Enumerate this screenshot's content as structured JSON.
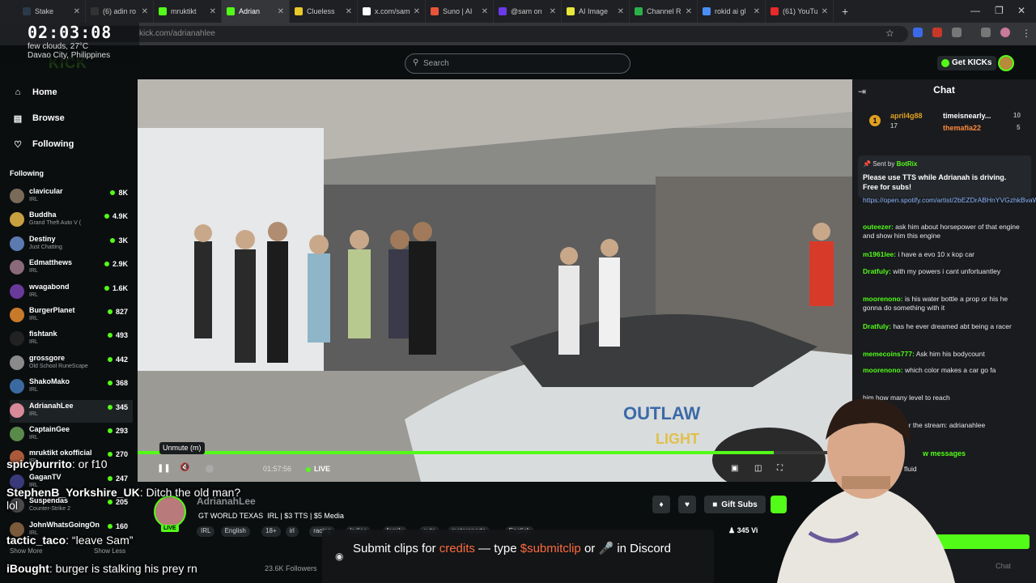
{
  "browser": {
    "tabs": [
      {
        "label": "Stake",
        "color": "#2b3a4a",
        "active": false
      },
      {
        "label": "(6) adin ro",
        "color": "#333",
        "active": false
      },
      {
        "label": "mruktikt",
        "color": "#53fc18",
        "active": false
      },
      {
        "label": "Adrian",
        "color": "#53fc18",
        "active": true
      },
      {
        "label": "Clueless",
        "color": "#e9c82a",
        "active": false
      },
      {
        "label": "x.com/sam",
        "color": "#fff",
        "active": false
      },
      {
        "label": "Suno | AI",
        "color": "#e8553a",
        "active": false
      },
      {
        "label": "@sam on",
        "color": "#6b3ae8",
        "active": false
      },
      {
        "label": "AI Image",
        "color": "#e8e83a",
        "active": false
      },
      {
        "label": "Channel R",
        "color": "#2ab04a",
        "active": false
      },
      {
        "label": "rokid ai gl",
        "color": "#4a8ef5",
        "active": false
      },
      {
        "label": "(61) YouTu",
        "color": "#e82a2a",
        "active": false
      }
    ],
    "address": "kick.com/adrianahlee"
  },
  "clock": {
    "time": "02:03:08",
    "weather": "few clouds, 27°C",
    "location": "Davao City, Philippines"
  },
  "header": {
    "search_placeholder": "Search",
    "get_kicks": "Get KICKs",
    "logo": "KICK"
  },
  "nav": {
    "home": "Home",
    "browse": "Browse",
    "following": "Following"
  },
  "following": {
    "header": "Following",
    "channels": [
      {
        "name": "clavicular",
        "category": "IRL",
        "viewers": "8K",
        "color": "#7a6a5a"
      },
      {
        "name": "Buddha",
        "category": "Grand Theft Auto V (",
        "viewers": "4.9K",
        "color": "#c8a040"
      },
      {
        "name": "Destiny",
        "category": "Just Chatting",
        "viewers": "3K",
        "color": "#5a7ab0"
      },
      {
        "name": "Edmatthews",
        "category": "IRL",
        "viewers": "2.9K",
        "color": "#8a6a7a"
      },
      {
        "name": "wvagabond",
        "category": "IRL",
        "viewers": "1.6K",
        "color": "#6a3a9a"
      },
      {
        "name": "BurgerPlanet",
        "category": "IRL",
        "viewers": "827",
        "color": "#c87a2a"
      },
      {
        "name": "fishtank",
        "category": "IRL",
        "viewers": "493",
        "color": "#222"
      },
      {
        "name": "grossgore",
        "category": "Old School RuneScape",
        "viewers": "442",
        "color": "#8a8a8a"
      },
      {
        "name": "ShakoMako",
        "category": "IRL",
        "viewers": "368",
        "color": "#3a6aa0"
      },
      {
        "name": "AdrianahLee",
        "category": "IRL",
        "viewers": "345",
        "color": "#d88a9a"
      },
      {
        "name": "CaptainGee",
        "category": "IRL",
        "viewers": "293",
        "color": "#5a8a4a"
      },
      {
        "name": "mruktikt okofficial",
        "category": "IRL",
        "viewers": "270",
        "color": "#aa5a3a"
      },
      {
        "name": "GaganTV",
        "category": "IRL",
        "viewers": "247",
        "color": "#3a3a7a"
      },
      {
        "name": "Suspendas",
        "category": "Counter-Strike 2",
        "viewers": "205",
        "color": "#4a4a4a"
      },
      {
        "name": "JohnWhatsGoingOn",
        "category": "IRL",
        "viewers": "160",
        "color": "#7a5a3a"
      }
    ],
    "show_more": "Show More",
    "show_less": "Show Less"
  },
  "player": {
    "tooltip": "Unmute (m)",
    "elapsed": "01:57:56",
    "live": "LIVE",
    "progress": 0.89
  },
  "stream": {
    "streamer": "AdrianahLee",
    "live_badge": "LIVE",
    "title": "GT WORLD TEXAS  IRL | $3 TTS | $5 Media",
    "tags": [
      "IRL",
      "English",
      "18+",
      "irl",
      "racing",
      "ladies",
      "family",
      "cute",
      "motorsports",
      "English"
    ],
    "viewers": "345 Vi",
    "followers": "23.6K Followers",
    "gift_subs": "Gift Subs"
  },
  "chat": {
    "title": "Chat",
    "gifters": [
      {
        "rank": "1",
        "name": "april4g88",
        "count": "17"
      },
      {
        "name": "timeisnearly...",
        "count": "10"
      },
      {
        "name": "themafia22",
        "count": "5"
      }
    ],
    "pinned": {
      "sent_by_label": "Sent by",
      "sender": "BotRix",
      "message": "Please use TTS while Adrianah is driving. Free for subs!"
    },
    "messages": [
      {
        "user": "",
        "text": "https://open.spotify.com/artist/2bEZDrABHnYVGzhkBvaWO",
        "color": "#8ab4f8"
      },
      {
        "user": "outeezer:",
        "text": "ask him about horsepower of that engine and show him this engine",
        "color": "#53fc18"
      },
      {
        "user": "m1961lee:",
        "text": "i have a evo 10 x kop car",
        "color": "#53fc18"
      },
      {
        "user": "Dratfuly:",
        "text": "with my powers i cant unfortuantley",
        "color": "#53fc18"
      },
      {
        "user": "moorenono:",
        "text": "is his water bottle a prop or his he gonna do something with it",
        "color": "#53fc18"
      },
      {
        "user": "Dratfuly:",
        "text": "has he ever dreamed abt being a racer",
        "color": "#53fc18"
      },
      {
        "user": "memecoins777:",
        "text": "Ask him his bodycount",
        "color": "#53fc18"
      },
      {
        "user": "moorenono:",
        "text": "which color makes a car go fa",
        "color": "#53fc18"
      },
      {
        "user": "",
        "text": "him how many level to reach",
        "color": "#53fc18"
      },
      {
        "user": "",
        "text": "buy supplies for the stream: adrianahlee",
        "color": "#53fc18"
      },
      {
        "user": "",
        "text": "him for wiper fluid",
        "color": "#53fc18"
      }
    ],
    "new_messages": "w messages",
    "send": "Chat"
  },
  "overlay_chat": [
    {
      "user": "spicyburrito",
      "text": ": or f10",
      "color": "#ffffff"
    },
    {
      "user": "StephenB_Yorkshire_UK",
      "text": ": Ditch the old man?",
      "color": "#ffffff"
    },
    {
      "user": "",
      "text": "lol",
      "color": "#ffffff"
    },
    {
      "user": "tactic_taco",
      "text": ": “leave Sam”",
      "color": "#ffffff"
    },
    {
      "user": "iBought",
      "text": ": burger is stalking his prey rn",
      "color": "#ffffff"
    }
  ],
  "banner": {
    "prefix": "Submit clips for ",
    "credits": "credits",
    "middle": " — type ",
    "command": "$submitclip",
    "suffix": " or ",
    "end": " in Discord"
  },
  "colors": {
    "accent": "#53fc18",
    "background": "#0b0e0f",
    "chat_bg": "#191b1f"
  }
}
